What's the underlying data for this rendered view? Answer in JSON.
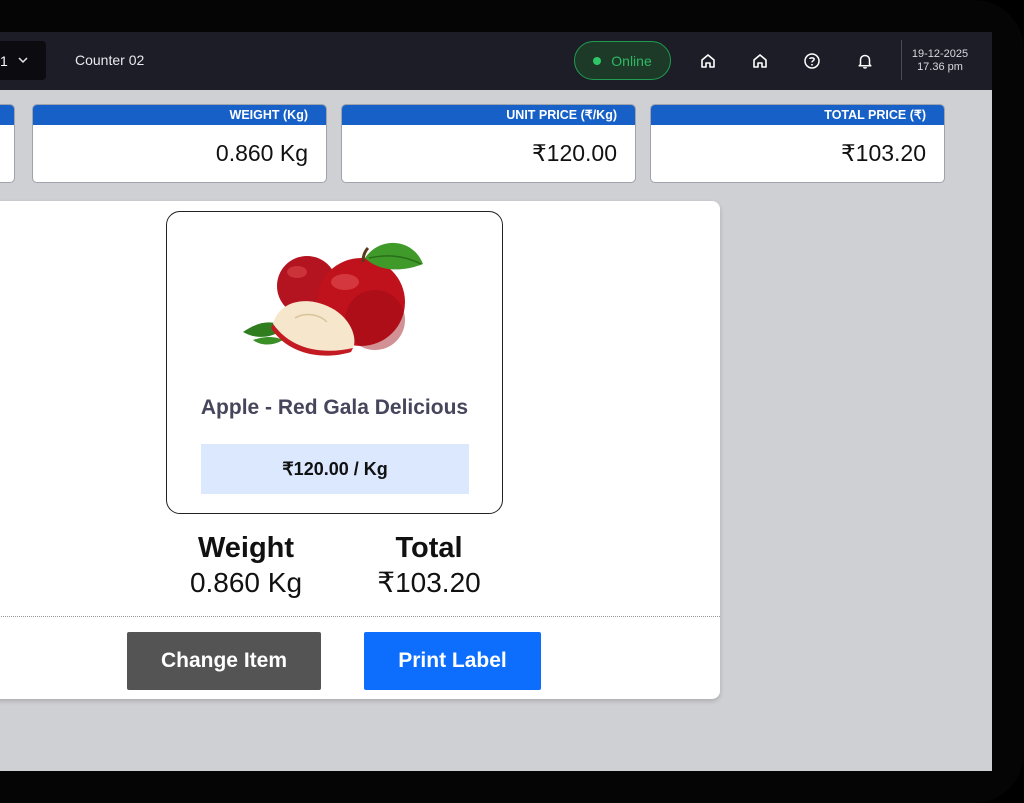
{
  "header": {
    "counter_select_value": "1",
    "counter_label": "Counter 02",
    "status": {
      "label": "Online",
      "color": "#2eb862"
    },
    "icons": [
      "home-icon",
      "home-icon",
      "help-icon",
      "bell-icon"
    ],
    "date": "19-12-2025",
    "time": "17.36 pm"
  },
  "metrics": [
    {
      "label": "WEIGHT (Kg)",
      "value": "0.860 Kg"
    },
    {
      "label": "UNIT PRICE (₹/Kg)",
      "value": "₹120.00"
    },
    {
      "label": "TOTAL PRICE (₹)",
      "value": "₹103.20"
    }
  ],
  "item": {
    "name": "Apple - Red Gala Delicious",
    "price_label": "₹120.00 / Kg",
    "image": "red-apple-image"
  },
  "summary": {
    "weight_label": "Weight",
    "weight_value": "0.860 Kg",
    "total_label": "Total",
    "total_value": "₹103.20"
  },
  "actions": {
    "change_item": "Change Item",
    "print_label": "Print Label"
  },
  "colors": {
    "accent_blue": "#0d6efd",
    "header_blue": "#1660c8",
    "price_highlight": "#dbe8fd",
    "topbar_bg": "#1c1d26",
    "secondary_button": "#545454"
  }
}
